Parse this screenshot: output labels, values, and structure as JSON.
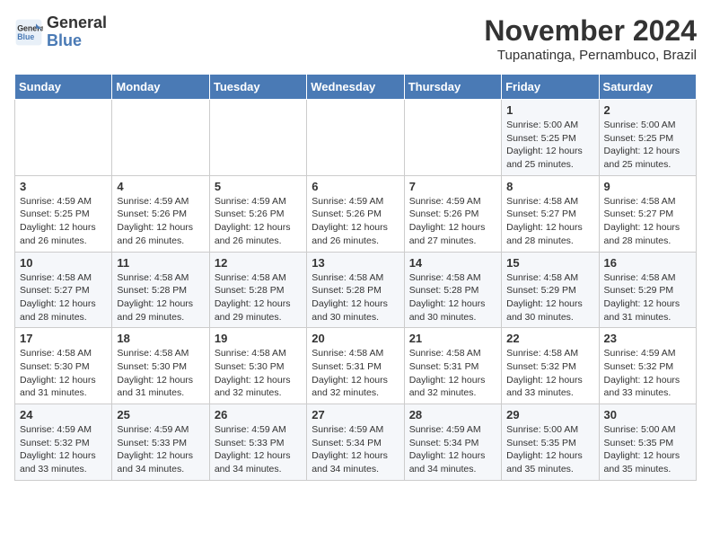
{
  "header": {
    "logo_line1": "General",
    "logo_line2": "Blue",
    "title": "November 2024",
    "subtitle": "Tupanatinga, Pernambuco, Brazil"
  },
  "weekdays": [
    "Sunday",
    "Monday",
    "Tuesday",
    "Wednesday",
    "Thursday",
    "Friday",
    "Saturday"
  ],
  "weeks": [
    [
      {
        "day": "",
        "info": ""
      },
      {
        "day": "",
        "info": ""
      },
      {
        "day": "",
        "info": ""
      },
      {
        "day": "",
        "info": ""
      },
      {
        "day": "",
        "info": ""
      },
      {
        "day": "1",
        "info": "Sunrise: 5:00 AM\nSunset: 5:25 PM\nDaylight: 12 hours and 25 minutes."
      },
      {
        "day": "2",
        "info": "Sunrise: 5:00 AM\nSunset: 5:25 PM\nDaylight: 12 hours and 25 minutes."
      }
    ],
    [
      {
        "day": "3",
        "info": "Sunrise: 4:59 AM\nSunset: 5:25 PM\nDaylight: 12 hours and 26 minutes."
      },
      {
        "day": "4",
        "info": "Sunrise: 4:59 AM\nSunset: 5:26 PM\nDaylight: 12 hours and 26 minutes."
      },
      {
        "day": "5",
        "info": "Sunrise: 4:59 AM\nSunset: 5:26 PM\nDaylight: 12 hours and 26 minutes."
      },
      {
        "day": "6",
        "info": "Sunrise: 4:59 AM\nSunset: 5:26 PM\nDaylight: 12 hours and 26 minutes."
      },
      {
        "day": "7",
        "info": "Sunrise: 4:59 AM\nSunset: 5:26 PM\nDaylight: 12 hours and 27 minutes."
      },
      {
        "day": "8",
        "info": "Sunrise: 4:58 AM\nSunset: 5:27 PM\nDaylight: 12 hours and 28 minutes."
      },
      {
        "day": "9",
        "info": "Sunrise: 4:58 AM\nSunset: 5:27 PM\nDaylight: 12 hours and 28 minutes."
      }
    ],
    [
      {
        "day": "10",
        "info": "Sunrise: 4:58 AM\nSunset: 5:27 PM\nDaylight: 12 hours and 28 minutes."
      },
      {
        "day": "11",
        "info": "Sunrise: 4:58 AM\nSunset: 5:28 PM\nDaylight: 12 hours and 29 minutes."
      },
      {
        "day": "12",
        "info": "Sunrise: 4:58 AM\nSunset: 5:28 PM\nDaylight: 12 hours and 29 minutes."
      },
      {
        "day": "13",
        "info": "Sunrise: 4:58 AM\nSunset: 5:28 PM\nDaylight: 12 hours and 30 minutes."
      },
      {
        "day": "14",
        "info": "Sunrise: 4:58 AM\nSunset: 5:28 PM\nDaylight: 12 hours and 30 minutes."
      },
      {
        "day": "15",
        "info": "Sunrise: 4:58 AM\nSunset: 5:29 PM\nDaylight: 12 hours and 30 minutes."
      },
      {
        "day": "16",
        "info": "Sunrise: 4:58 AM\nSunset: 5:29 PM\nDaylight: 12 hours and 31 minutes."
      }
    ],
    [
      {
        "day": "17",
        "info": "Sunrise: 4:58 AM\nSunset: 5:30 PM\nDaylight: 12 hours and 31 minutes."
      },
      {
        "day": "18",
        "info": "Sunrise: 4:58 AM\nSunset: 5:30 PM\nDaylight: 12 hours and 31 minutes."
      },
      {
        "day": "19",
        "info": "Sunrise: 4:58 AM\nSunset: 5:30 PM\nDaylight: 12 hours and 32 minutes."
      },
      {
        "day": "20",
        "info": "Sunrise: 4:58 AM\nSunset: 5:31 PM\nDaylight: 12 hours and 32 minutes."
      },
      {
        "day": "21",
        "info": "Sunrise: 4:58 AM\nSunset: 5:31 PM\nDaylight: 12 hours and 32 minutes."
      },
      {
        "day": "22",
        "info": "Sunrise: 4:58 AM\nSunset: 5:32 PM\nDaylight: 12 hours and 33 minutes."
      },
      {
        "day": "23",
        "info": "Sunrise: 4:59 AM\nSunset: 5:32 PM\nDaylight: 12 hours and 33 minutes."
      }
    ],
    [
      {
        "day": "24",
        "info": "Sunrise: 4:59 AM\nSunset: 5:32 PM\nDaylight: 12 hours and 33 minutes."
      },
      {
        "day": "25",
        "info": "Sunrise: 4:59 AM\nSunset: 5:33 PM\nDaylight: 12 hours and 34 minutes."
      },
      {
        "day": "26",
        "info": "Sunrise: 4:59 AM\nSunset: 5:33 PM\nDaylight: 12 hours and 34 minutes."
      },
      {
        "day": "27",
        "info": "Sunrise: 4:59 AM\nSunset: 5:34 PM\nDaylight: 12 hours and 34 minutes."
      },
      {
        "day": "28",
        "info": "Sunrise: 4:59 AM\nSunset: 5:34 PM\nDaylight: 12 hours and 34 minutes."
      },
      {
        "day": "29",
        "info": "Sunrise: 5:00 AM\nSunset: 5:35 PM\nDaylight: 12 hours and 35 minutes."
      },
      {
        "day": "30",
        "info": "Sunrise: 5:00 AM\nSunset: 5:35 PM\nDaylight: 12 hours and 35 minutes."
      }
    ]
  ]
}
